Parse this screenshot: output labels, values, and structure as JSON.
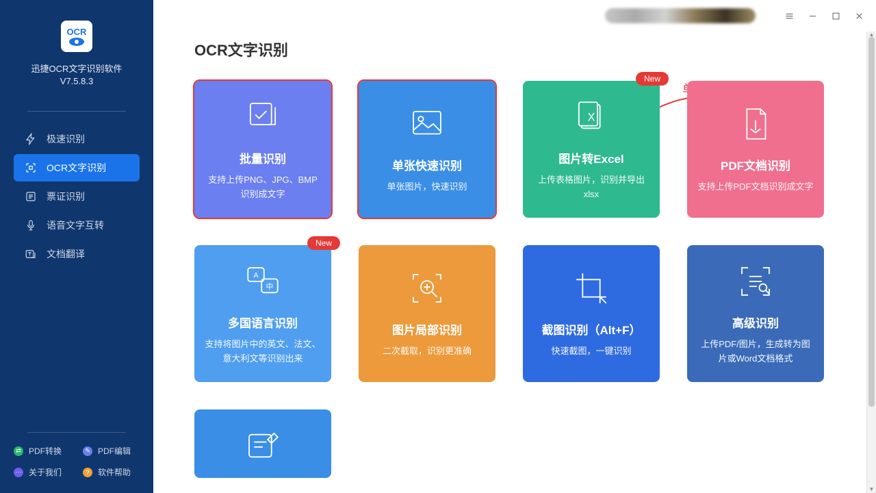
{
  "app": {
    "name": "迅捷OCR文字识别软件",
    "version": "V7.5.8.3"
  },
  "sidebar": {
    "items": [
      {
        "label": "极速识别"
      },
      {
        "label": "OCR文字识别"
      },
      {
        "label": "票证识别"
      },
      {
        "label": "语音文字互转"
      },
      {
        "label": "文档翻译"
      }
    ],
    "bottom": [
      {
        "label": "PDF转换"
      },
      {
        "label": "PDF编辑"
      },
      {
        "label": "关于我们"
      },
      {
        "label": "软件帮助"
      }
    ]
  },
  "page": {
    "title": "OCR文字识别",
    "annotation": "单张识别为例"
  },
  "cards": [
    {
      "title": "批量识别",
      "desc": "支持上传PNG、JPG、BMP识别成文字",
      "badge": ""
    },
    {
      "title": "单张快速识别",
      "desc": "单张图片，快速识别",
      "badge": ""
    },
    {
      "title": "图片转Excel",
      "desc": "上传表格图片，识别并导出xlsx",
      "badge": "New"
    },
    {
      "title": "PDF文档识别",
      "desc": "支持上传PDF文档识别成文字",
      "badge": ""
    },
    {
      "title": "多国语言识别",
      "desc": "支持将图片中的英文、法文、意大利文等识别出来",
      "badge": "New"
    },
    {
      "title": "图片局部识别",
      "desc": "二次截取，识别更准确",
      "badge": ""
    },
    {
      "title": "截图识别（Alt+F）",
      "desc": "快速截图，一键识别",
      "badge": ""
    },
    {
      "title": "高级识别",
      "desc": "上传PDF/图片，生成转为图片或Word文档格式",
      "badge": ""
    },
    {
      "title": "",
      "desc": "",
      "badge": ""
    }
  ]
}
